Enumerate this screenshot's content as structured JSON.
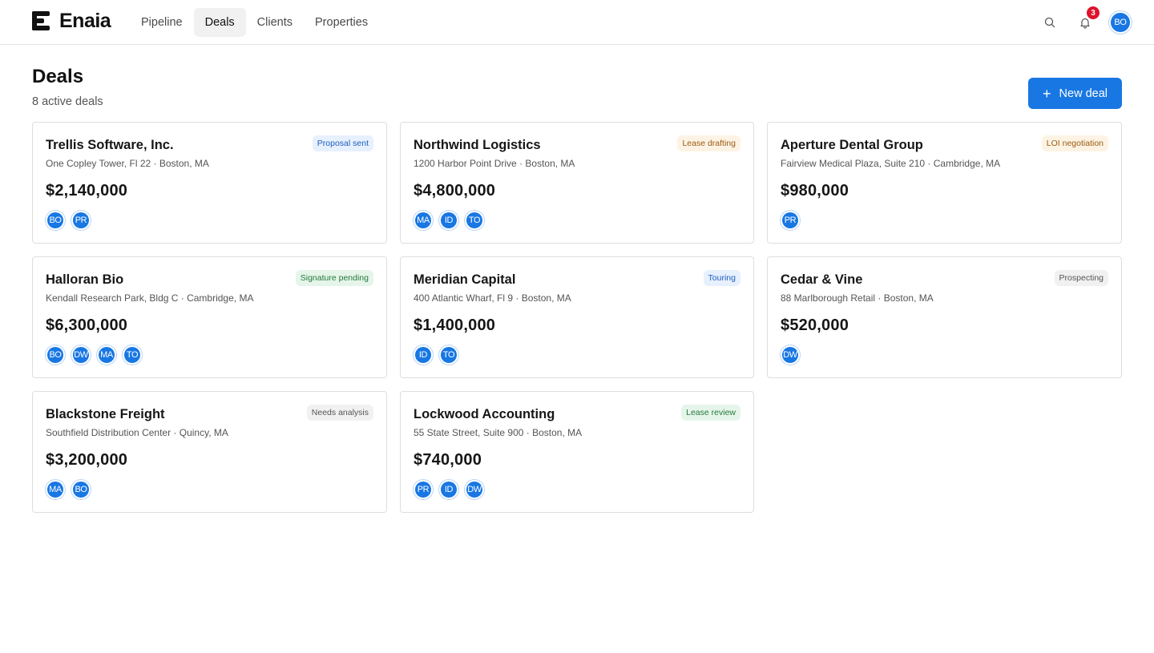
{
  "app": {
    "name": "Enaia"
  },
  "nav": {
    "tabs": [
      {
        "label": "Pipeline"
      },
      {
        "label": "Deals"
      },
      {
        "label": "Clients"
      },
      {
        "label": "Properties"
      }
    ]
  },
  "topbar": {
    "search_icon": "search-icon",
    "bell_icon": "bell-icon",
    "notification_count": "3",
    "user_initials": "BO"
  },
  "header": {
    "title": "Deals",
    "subtitle": "8 active deals",
    "new_deal_label": "New deal",
    "new_deal_icon": "plus-icon"
  },
  "colors": {
    "accent": "#1877e3",
    "notification": "#e0122a"
  },
  "deals": [
    {
      "name": "Trellis Software, Inc.",
      "address": "One Copley Tower, Fl 22 · Boston, MA",
      "value": "$2,140,000",
      "status": "Proposal sent",
      "status_bg": "#e7f0fd",
      "status_fg": "#1f5fbf",
      "team": [
        "BO",
        "PR"
      ]
    },
    {
      "name": "Northwind Logistics",
      "address": "1200 Harbor Point Drive · Boston, MA",
      "value": "$4,800,000",
      "status": "Lease drafting",
      "status_bg": "#fdf3e4",
      "status_fg": "#9a5b12",
      "team": [
        "MA",
        "ID",
        "TO"
      ]
    },
    {
      "name": "Aperture Dental Group",
      "address": "Fairview Medical Plaza, Suite 210 · Cambridge, MA",
      "value": "$980,000",
      "status": "LOI negotiation",
      "status_bg": "#fdf3e4",
      "status_fg": "#9a5b12",
      "team": [
        "PR"
      ]
    },
    {
      "name": "Halloran Bio",
      "address": "Kendall Research Park, Bldg C · Cambridge, MA",
      "value": "$6,300,000",
      "status": "Signature pending",
      "status_bg": "#e6f5ea",
      "status_fg": "#237a3b",
      "team": [
        "BO",
        "DW",
        "MA",
        "TO"
      ]
    },
    {
      "name": "Meridian Capital",
      "address": "400 Atlantic Wharf, Fl 9 · Boston, MA",
      "value": "$1,400,000",
      "status": "Touring",
      "status_bg": "#e7f0fd",
      "status_fg": "#1f5fbf",
      "team": [
        "ID",
        "TO"
      ]
    },
    {
      "name": "Cedar & Vine",
      "address": "88 Marlborough Retail · Boston, MA",
      "value": "$520,000",
      "status": "Prospecting",
      "status_bg": "#f1f1f1",
      "status_fg": "#555555",
      "team": [
        "DW"
      ]
    },
    {
      "name": "Blackstone Freight",
      "address": "Southfield Distribution Center · Quincy, MA",
      "value": "$3,200,000",
      "status": "Needs analysis",
      "status_bg": "#f1f1f1",
      "status_fg": "#555555",
      "team": [
        "MA",
        "BO"
      ]
    },
    {
      "name": "Lockwood Accounting",
      "address": "55 State Street, Suite 900 · Boston, MA",
      "value": "$740,000",
      "status": "Lease review",
      "status_bg": "#e6f5ea",
      "status_fg": "#237a3b",
      "team": [
        "PR",
        "ID",
        "DW"
      ]
    }
  ]
}
